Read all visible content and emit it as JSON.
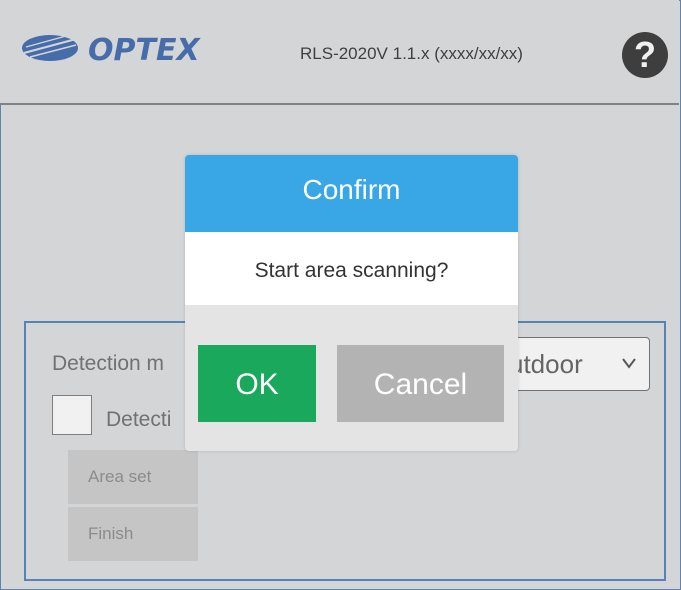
{
  "header": {
    "brand": "OPTEX",
    "model_version": "RLS-2020V 1.1.x (xxxx/xx/xx)",
    "help_glyph": "?"
  },
  "main": {
    "detection_mode_label": "Detection m",
    "detection_mode_value": "utdoor",
    "detection_checkbox_label": "Detecti",
    "area_set_label": "Area set",
    "finish_label": "Finish"
  },
  "dialog": {
    "title": "Confirm",
    "message": "Start area scanning?",
    "ok_label": "OK",
    "cancel_label": "Cancel"
  },
  "colors": {
    "dialog_title": "#39a7e6",
    "ok_button": "#1aa85d",
    "cancel_button": "#b3b3b3",
    "brand_blue": "#1b4fa0",
    "panel_border": "#2e6db4"
  },
  "icons": {
    "help": "question-circle-icon",
    "dropdown": "chevron-down-icon",
    "logo": "optex-logo"
  }
}
